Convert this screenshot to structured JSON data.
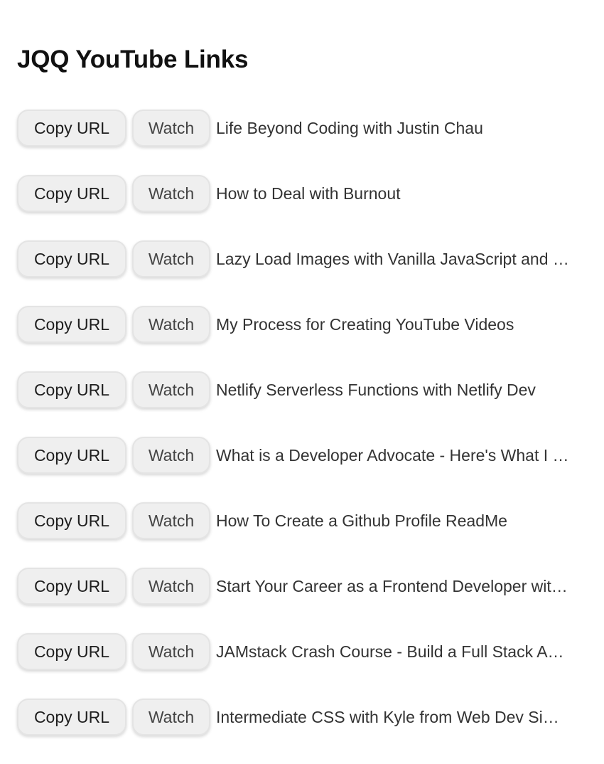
{
  "page": {
    "title": "JQQ YouTube Links"
  },
  "buttons": {
    "copy_label": "Copy URL",
    "watch_label": "Watch"
  },
  "videos": [
    {
      "title": "Life Beyond Coding with Justin Chau"
    },
    {
      "title": "How to Deal with Burnout"
    },
    {
      "title": "Lazy Load Images with Vanilla JavaScript and …"
    },
    {
      "title": "My Process for Creating YouTube Videos"
    },
    {
      "title": "Netlify Serverless Functions with Netlify Dev"
    },
    {
      "title": "What is a Developer Advocate - Here's What I …"
    },
    {
      "title": "How To Create a Github Profile ReadMe"
    },
    {
      "title": "Start Your Career as a Frontend Developer wit…"
    },
    {
      "title": "JAMstack Crash Course - Build a Full Stack A…"
    },
    {
      "title": "Intermediate CSS with Kyle from Web Dev Si…"
    }
  ]
}
